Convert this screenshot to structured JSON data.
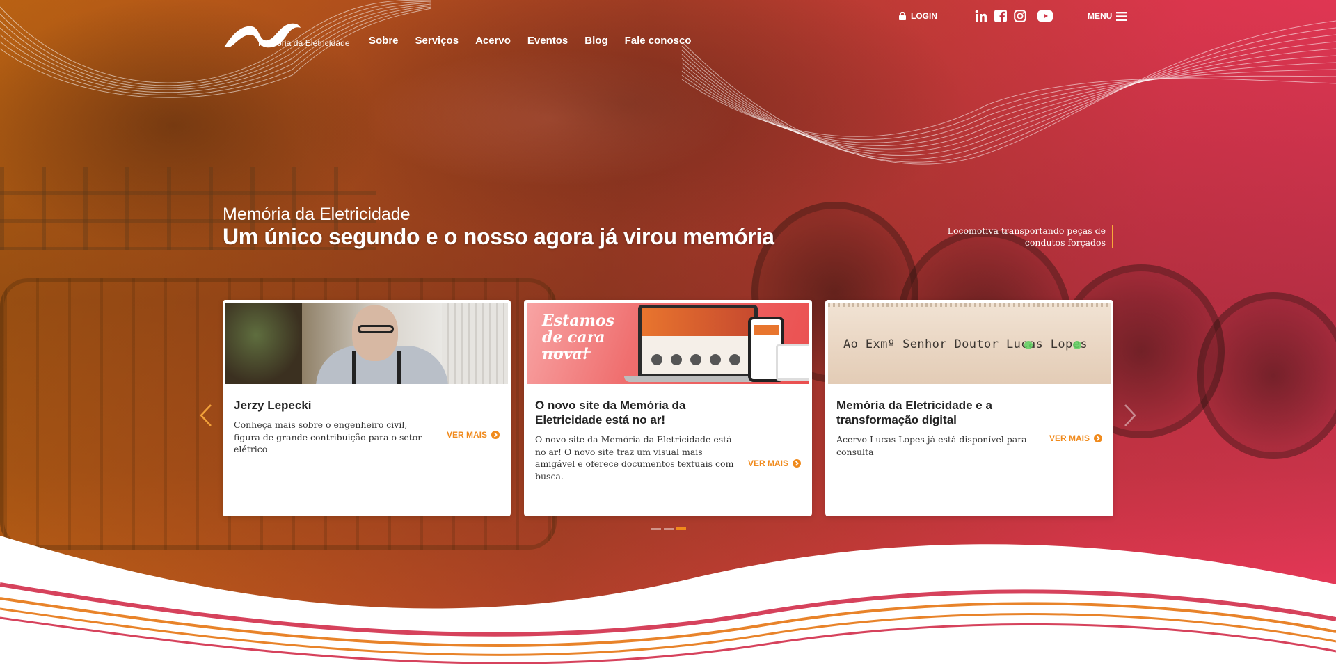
{
  "header": {
    "logo_text": "Memória da Eletricidade",
    "nav": [
      "Sobre",
      "Serviços",
      "Acervo",
      "Eventos",
      "Blog",
      "Fale conosco"
    ],
    "login_label": "LOGIN",
    "menu_label": "MENU",
    "social_icons": [
      "linkedin-icon",
      "facebook-icon",
      "instagram-icon",
      "youtube-icon"
    ]
  },
  "hero": {
    "kicker": "Memória da Eletricidade",
    "headline": "Um único segundo e o nosso agora já virou memória",
    "caption": "Locomotiva transportando peças de condutos forçados"
  },
  "cards": [
    {
      "title": "Jerzy Lepecki",
      "text": "Conheça mais sobre o engenheiro civil, figura de grande contribuição para o setor elétrico",
      "more": "VER MAIS"
    },
    {
      "title": "O novo site da Memória da Eletricidade está no ar!",
      "text": "O novo site da Memória da Eletricidade está no ar! O novo site traz um visual mais amigável e oferece documentos textuais com busca.",
      "more": "VER MAIS",
      "thumb_text": "Estamos de cara nova!"
    },
    {
      "title": "Memória da Eletricidade e a transformação digital",
      "text": "Acervo Lucas Lopes já está disponível para consulta",
      "more": "VER MAIS",
      "thumb_text": "Ao Exmº Senhor Doutor Lucas Lopes"
    }
  ],
  "carousel": {
    "active_index": 2,
    "total": 3
  },
  "colors": {
    "accent": "#f08a1c",
    "gradient_left": "#c96a14",
    "gradient_right": "#f83a60",
    "wave_red": "#d6425c",
    "wave_orange": "#e8832a"
  }
}
